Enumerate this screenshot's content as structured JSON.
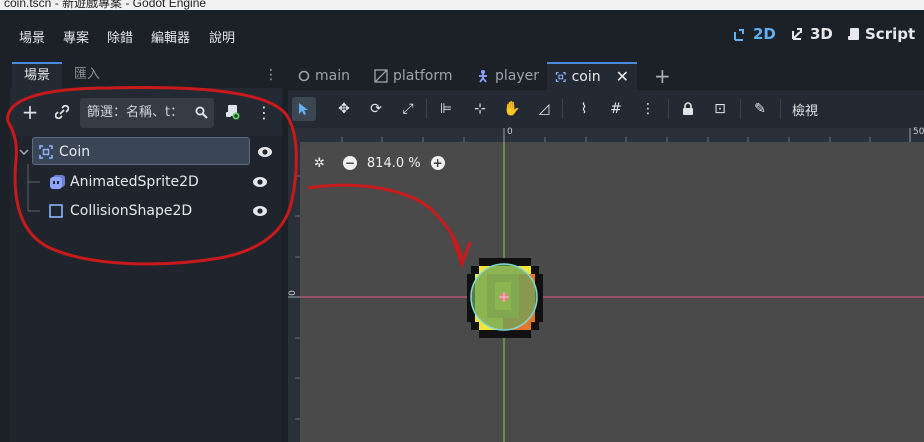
{
  "window": {
    "title": "coin.tscn - 新遊戲專案 - Godot Engine"
  },
  "menu": {
    "items": [
      "場景",
      "專案",
      "除錯",
      "編輯器",
      "說明"
    ],
    "modes": [
      {
        "label": "2D",
        "icon": "2d-icon",
        "active": true
      },
      {
        "label": "3D",
        "icon": "3d-icon",
        "active": false
      },
      {
        "label": "Script",
        "icon": "script-icon",
        "active": false
      }
    ]
  },
  "dock": {
    "tabs": [
      "場景",
      "匯入"
    ],
    "filter_placeholder": "篩選：名稱、t：",
    "tree": [
      {
        "label": "Coin",
        "icon": "node2d-icon"
      },
      {
        "label": "AnimatedSprite2D",
        "icon": "animated-sprite-icon"
      },
      {
        "label": "CollisionShape2D",
        "icon": "collision-shape-icon"
      }
    ]
  },
  "editor": {
    "tabs": [
      {
        "label": "main",
        "icon": "node-circle-icon"
      },
      {
        "label": "platform",
        "icon": "platform-icon"
      },
      {
        "label": "player",
        "icon": "player-icon"
      },
      {
        "label": "coin",
        "icon": "node2d-icon",
        "active": true
      }
    ],
    "view_menu": "檢視",
    "zoom": "814.0 %",
    "ruler": {
      "top_zero": "0",
      "top_right": "50",
      "left_zero": "0"
    }
  },
  "colors": {
    "accent": "#61b0f5",
    "annotation": "#c81a1a",
    "x_axis": "#e05a8a",
    "y_axis": "#9ccc4a"
  }
}
